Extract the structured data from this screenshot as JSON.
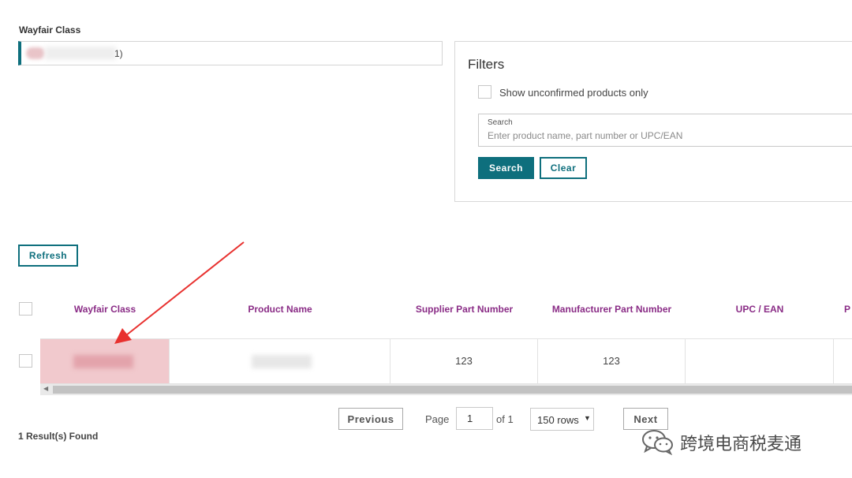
{
  "class_selector": {
    "label": "Wayfair Class",
    "value_suffix": "1)"
  },
  "filters": {
    "title": "Filters",
    "unconfirmed_label": "Show unconfirmed products only",
    "unconfirmed_checked": false,
    "search_label": "Search",
    "search_placeholder": "Enter product name, part number or UPC/EAN",
    "search_value": "",
    "search_button": "Search",
    "clear_button": "Clear"
  },
  "refresh_button": "Refresh",
  "table": {
    "columns": [
      "Wayfair Class",
      "Product Name",
      "Supplier Part Number",
      "Manufacturer Part Number",
      "UPC / EAN",
      "P"
    ],
    "rows": [
      {
        "wayfair_class": "",
        "product_name": "",
        "supplier_part_number": "123",
        "manufacturer_part_number": "123",
        "upc_ean": ""
      }
    ]
  },
  "pagination": {
    "previous": "Previous",
    "page_label": "Page",
    "page_value": "1",
    "of_label": "of 1",
    "rows_option": "150 rows",
    "next": "Next"
  },
  "results_text": "1 Result(s) Found",
  "watermark": {
    "text": "跨境电商税麦通"
  },
  "colors": {
    "accent": "#0e6f7d",
    "header_text": "#8a2c86",
    "highlight": "#f1c9cd",
    "arrow": "#e8312f"
  }
}
